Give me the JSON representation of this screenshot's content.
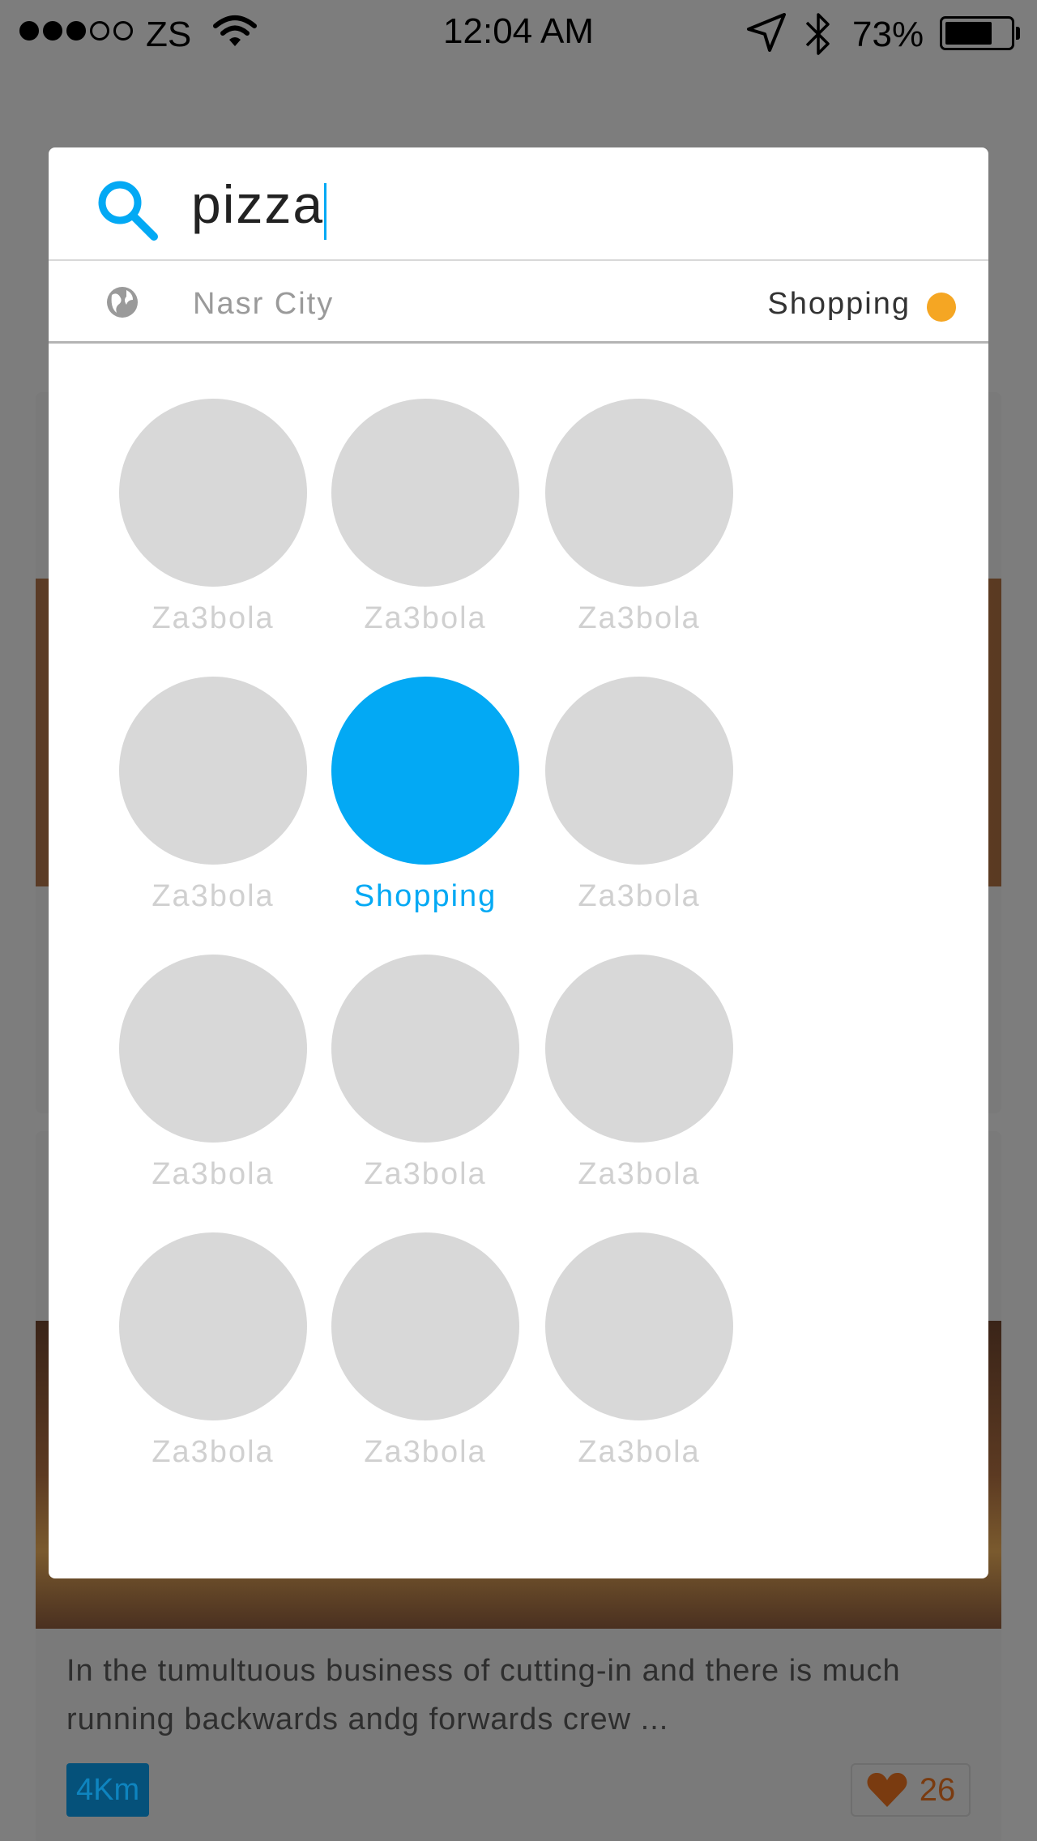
{
  "status_bar": {
    "carrier": "ZS",
    "time": "12:04 AM",
    "battery": "73%",
    "battery_level": 0.73,
    "signal_bars_filled": 3,
    "signal_bars_total": 5
  },
  "search": {
    "query": "pizza",
    "accent_color": "#03a9f4"
  },
  "filters": {
    "location": "Nasr City",
    "category": "Shopping",
    "category_dot_color": "#f5a623"
  },
  "categories": [
    {
      "label": "Za3bola",
      "selected": false
    },
    {
      "label": "Za3bola",
      "selected": false
    },
    {
      "label": "Za3bola",
      "selected": false
    },
    {
      "label": "Za3bola",
      "selected": false
    },
    {
      "label": "Shopping",
      "selected": true
    },
    {
      "label": "Za3bola",
      "selected": false
    },
    {
      "label": "Za3bola",
      "selected": false
    },
    {
      "label": "Za3bola",
      "selected": false
    },
    {
      "label": "Za3bola",
      "selected": false
    },
    {
      "label": "Za3bola",
      "selected": false
    },
    {
      "label": "Za3bola",
      "selected": false
    },
    {
      "label": "Za3bola",
      "selected": false
    }
  ],
  "feed": {
    "card": {
      "description": "In the tumultuous business of cutting-in and there is much running backwards andg forwards crew ...",
      "distance": "4Km",
      "likes": "26"
    }
  },
  "icons": {
    "search": "search-icon",
    "location_filter": "globe-icon",
    "like": "heart-icon"
  }
}
